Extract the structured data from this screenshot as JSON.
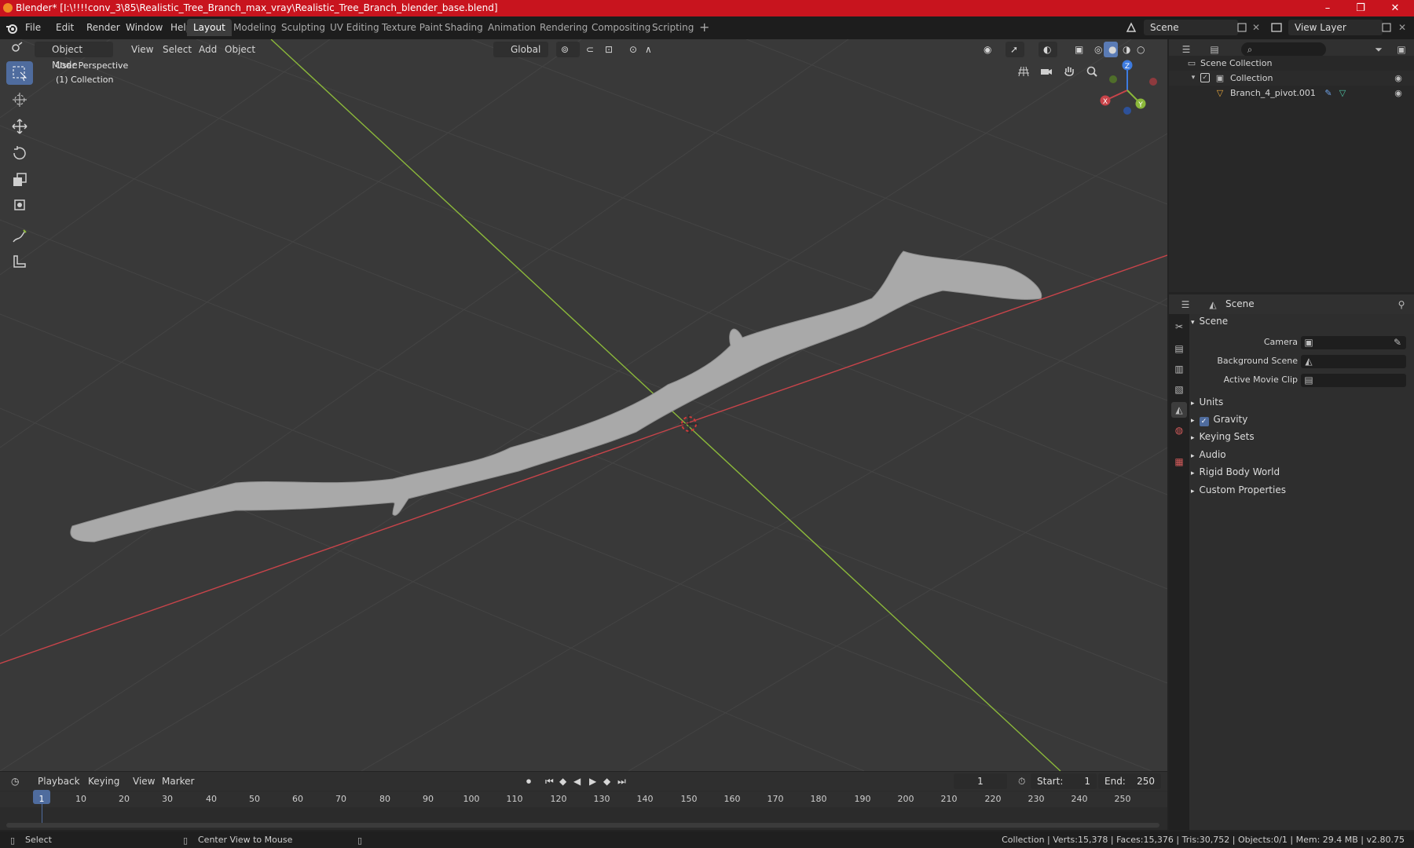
{
  "window": {
    "title": "Blender* [I:\\!!!!conv_3\\85\\Realistic_Tree_Branch_max_vray\\Realistic_Tree_Branch_blender_base.blend]",
    "minimize": "–",
    "maximize": "❐",
    "close": "✕"
  },
  "menu": [
    "File",
    "Edit",
    "Render",
    "Window",
    "Help"
  ],
  "workspaces": [
    "Layout",
    "Modeling",
    "Sculpting",
    "UV Editing",
    "Texture Paint",
    "Shading",
    "Animation",
    "Rendering",
    "Compositing",
    "Scripting"
  ],
  "workspace_add": "+",
  "scene_field": "Scene",
  "view_layer_field": "View Layer",
  "viewport": {
    "mode": "Object Mode",
    "menus": [
      "View",
      "Select",
      "Add",
      "Object"
    ],
    "transform_orientation": "Global",
    "overlay_title": "User Perspective",
    "overlay_subtitle": "(1) Collection",
    "gizmo": {
      "x": "X",
      "y": "Y",
      "z": "Z"
    },
    "colors": {
      "x_axis": "#c8444a",
      "y_axis": "#8bb83a",
      "z_axis": "#3d7be0",
      "background": "#393939",
      "grid": "#4a4a4a"
    }
  },
  "outliner": {
    "search_placeholder": "",
    "rows": [
      {
        "label": "Scene Collection"
      },
      {
        "label": "Collection"
      },
      {
        "label": "Branch_4_pivot.001"
      }
    ]
  },
  "properties": {
    "header_title": "Scene",
    "panel_title": "Scene",
    "fields": [
      {
        "label": "Camera"
      },
      {
        "label": "Background Scene"
      },
      {
        "label": "Active Movie Clip"
      }
    ],
    "panels": [
      "Units",
      "Gravity",
      "Keying Sets",
      "Audio",
      "Rigid Body World",
      "Custom Properties"
    ]
  },
  "timeline": {
    "menus": [
      "Playback",
      "Keying",
      "View",
      "Marker"
    ],
    "current_frame": "1",
    "start_label": "Start:",
    "start_value": "1",
    "end_label": "End:",
    "end_value": "250",
    "ticks": [
      "1",
      "10",
      "20",
      "30",
      "40",
      "50",
      "60",
      "70",
      "80",
      "90",
      "100",
      "110",
      "120",
      "130",
      "140",
      "150",
      "160",
      "170",
      "180",
      "190",
      "200",
      "210",
      "220",
      "230",
      "240",
      "250"
    ]
  },
  "status": {
    "left_action": "Select",
    "middle_action": "Center View to Mouse",
    "stats": "Collection | Verts:15,378 | Faces:15,376 | Tris:30,752 | Objects:0/1 | Mem: 29.4 MB | v2.80.75"
  }
}
